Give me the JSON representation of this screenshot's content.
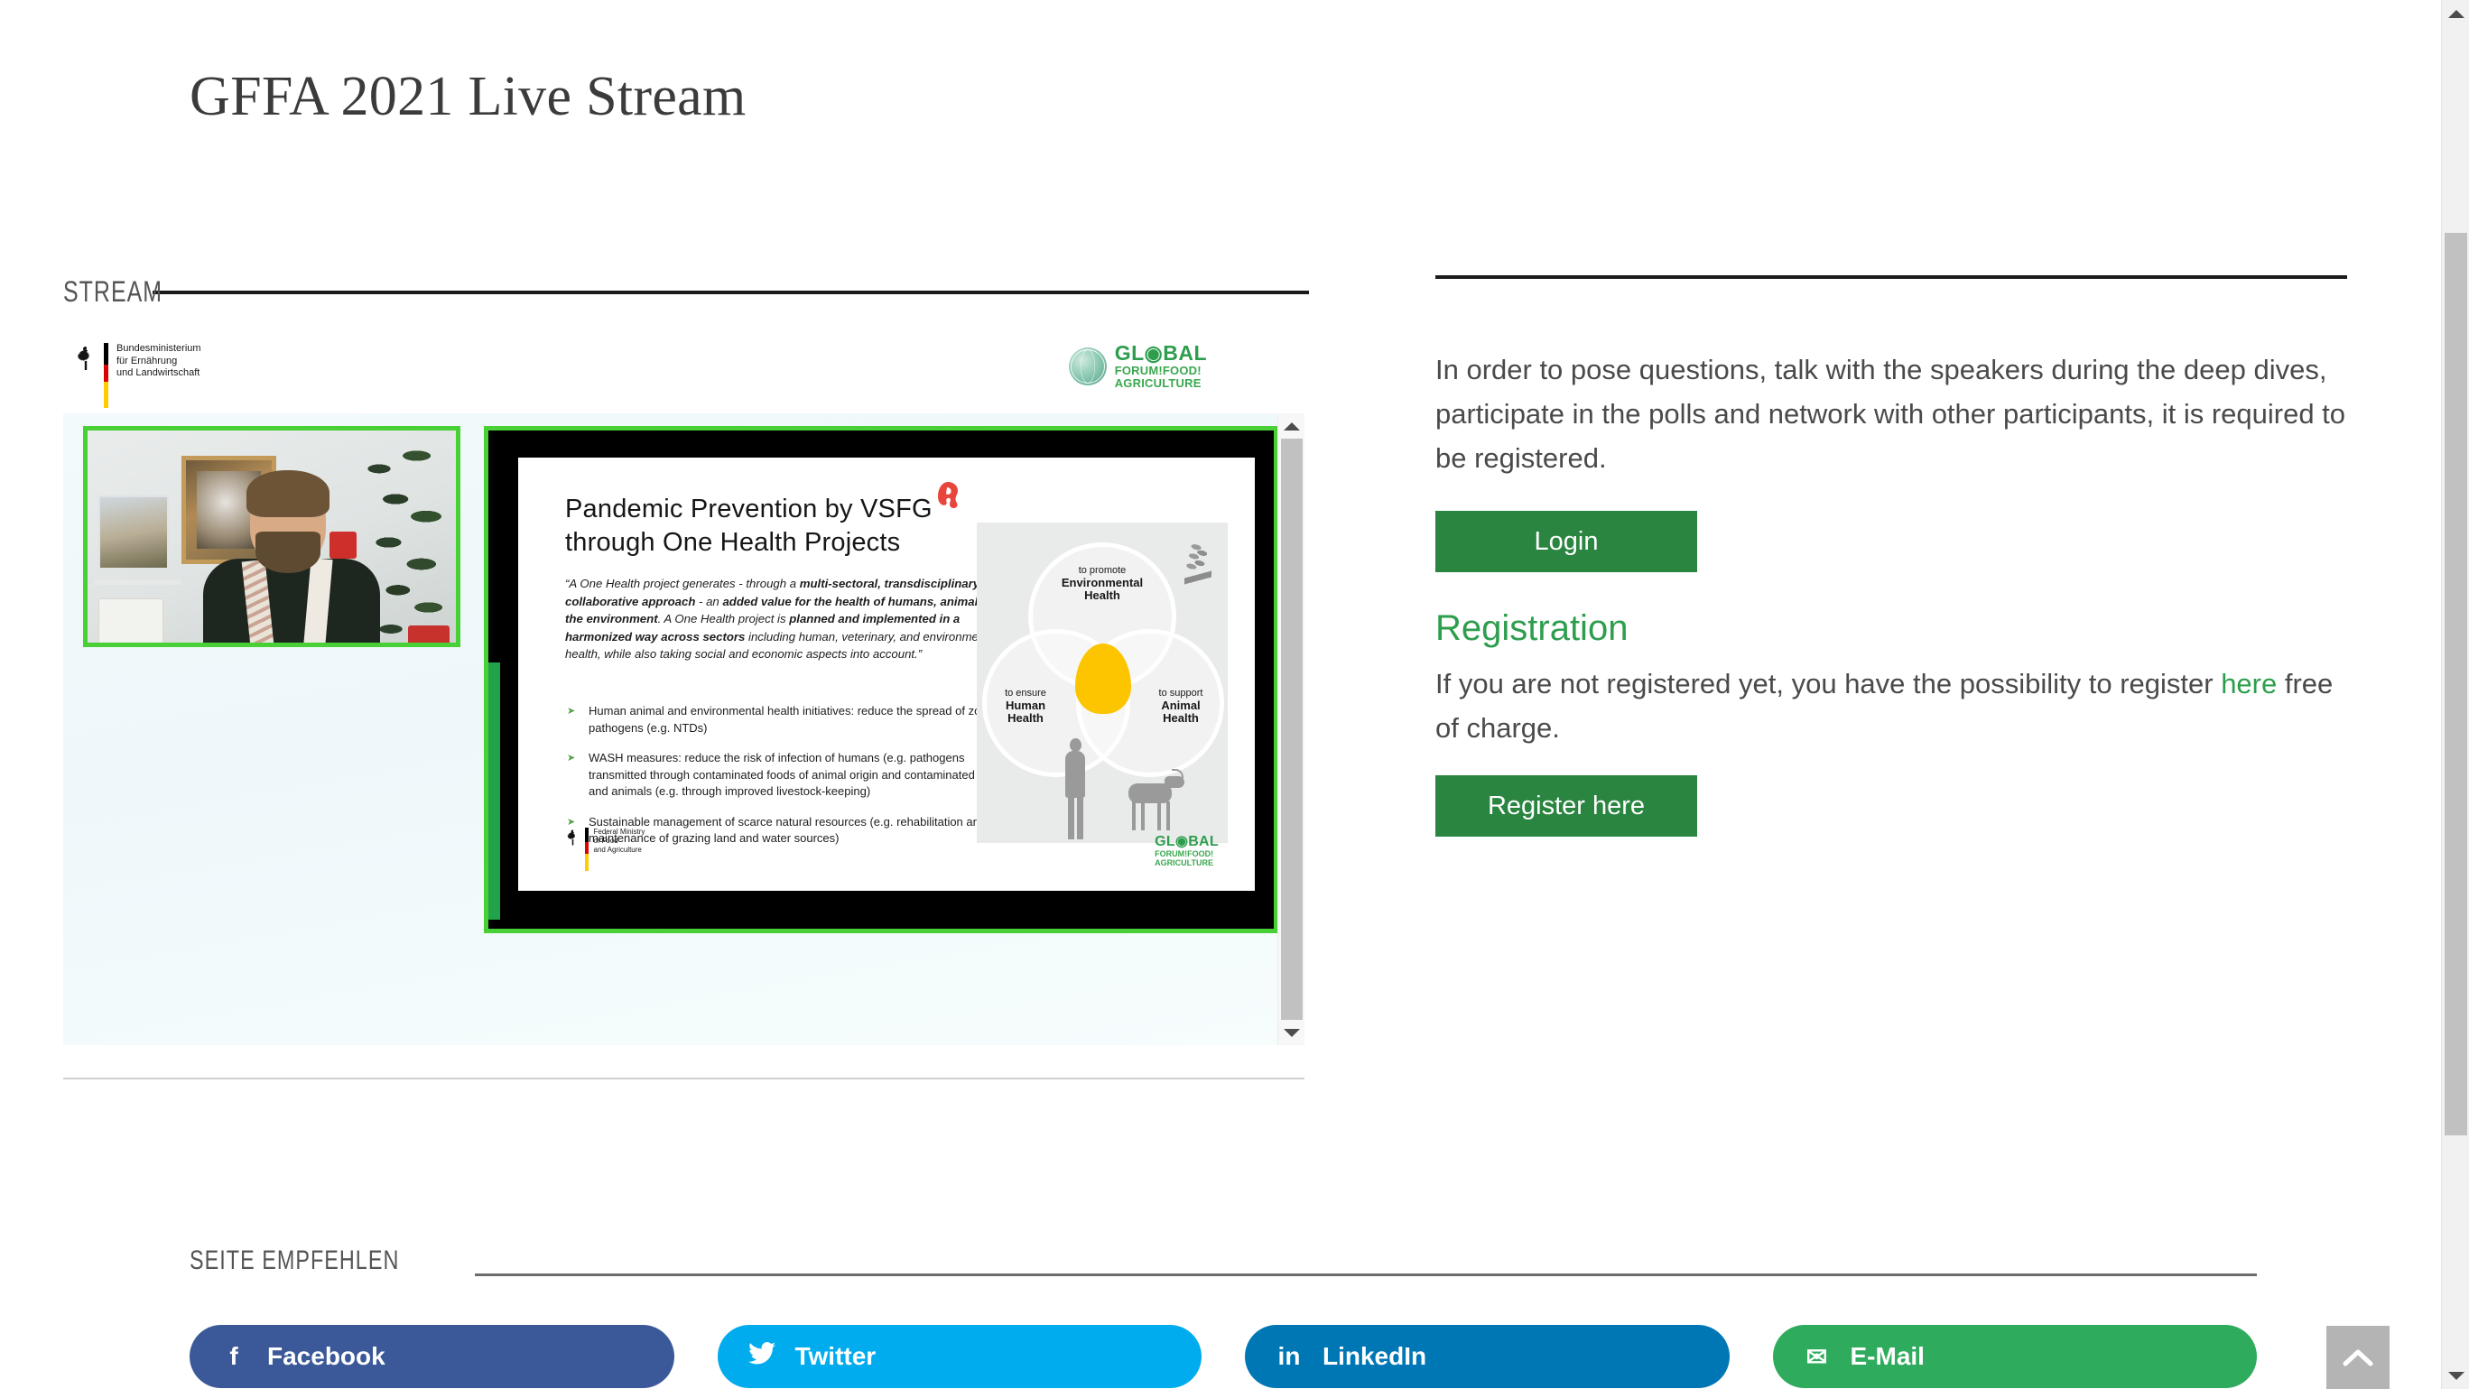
{
  "page": {
    "title": "GFFA 2021 Live Stream"
  },
  "stream_section": {
    "heading": "STREAM",
    "header_logos": {
      "ministry_de": "Bundesministerium\nfür Ernährung\nund Landwirtschaft",
      "ministry_de_line1": "Bundesministerium",
      "ministry_de_line2": "für Ernährung",
      "ministry_de_line3": "und Landwirtschaft",
      "gffa_line1": "GL◉BAL",
      "gffa_line2": "FORUM!FOOD!",
      "gffa_line3": "AGRICULTURE"
    },
    "video": {
      "speaker_tile_label": "speaker-webcam",
      "active_speaker_border_color": "#49d037",
      "slide": {
        "title_line1": "Pandemic Prevention by VSFG",
        "title_line2": "through One Health Projects",
        "quote_parts": [
          {
            "text": "“A One Health project generates - through a ",
            "bold": false
          },
          {
            "text": "multi-sectoral, transdisciplinary and collaborative approach",
            "bold": true
          },
          {
            "text": " - an ",
            "bold": false
          },
          {
            "text": "added value for the health of humans, animals and the environment",
            "bold": true
          },
          {
            "text": ". A One Health project is ",
            "bold": false
          },
          {
            "text": "planned and implemented in a harmonized way across sectors",
            "bold": true
          },
          {
            "text": " including human, veterinary, and environmental health, while also taking social and economic aspects into account.”",
            "bold": false
          }
        ],
        "bullets": [
          "Human animal and environmental health initiatives: reduce the spread of zoonotic pathogens (e.g. NTDs)",
          "WASH measures: reduce the risk of infection of humans (e.g. pathogens transmitted through contaminated foods of animal origin and contaminated water) and animals (e.g. through improved livestock-keeping)",
          "Sustainable management of scarce natural resources (e.g. rehabilitation and maintenance of grazing land and water sources)"
        ],
        "venn": {
          "top_small": "to promote",
          "top_big": "Environmental Health",
          "top_big_l1": "Environmental",
          "top_big_l2": "Health",
          "left_small": "to ensure",
          "left_big_l1": "Human",
          "left_big_l2": "Health",
          "right_small": "to support",
          "right_big_l1": "Animal",
          "right_big_l2": "Health",
          "center_color": "#fcc500"
        },
        "footer": {
          "ministry_en_line1": "Federal Ministry",
          "ministry_en_line2": "of Food",
          "ministry_en_line3": "and Agriculture",
          "gffa_line1": "GL◉BAL",
          "gffa_line2": "FORUM!FOOD!",
          "gffa_line3": "AGRICULTURE"
        }
      }
    }
  },
  "info_panel": {
    "intro": "In order to pose questions, talk with the speakers during the deep dives, participate in the polls and network with other participants, it is required to be registered.",
    "login_label": "Login",
    "registration_heading": "Registration",
    "registration_text_before": "If you are not registered yet, you have the possibility to register ",
    "registration_link": "here",
    "registration_text_after": " free of charge.",
    "register_label": "Register here",
    "accent_green": "#2a8540",
    "link_green": "#2e9e4e"
  },
  "share_section": {
    "heading": "SEITE EMPFEHLEN",
    "buttons": [
      {
        "label": "Facebook",
        "icon": "facebook-icon",
        "glyph": "f",
        "color": "#3b5998"
      },
      {
        "label": "Twitter",
        "icon": "twitter-icon",
        "glyph": "ᴠ",
        "color": "#00acee"
      },
      {
        "label": "LinkedIn",
        "icon": "linkedin-icon",
        "glyph": "in",
        "color": "#0077b5"
      },
      {
        "label": "E-Mail",
        "icon": "envelope-icon",
        "glyph": "✉",
        "color": "#2eab5c"
      }
    ]
  },
  "scroll_top": {
    "icon": "chevron-up-icon"
  }
}
